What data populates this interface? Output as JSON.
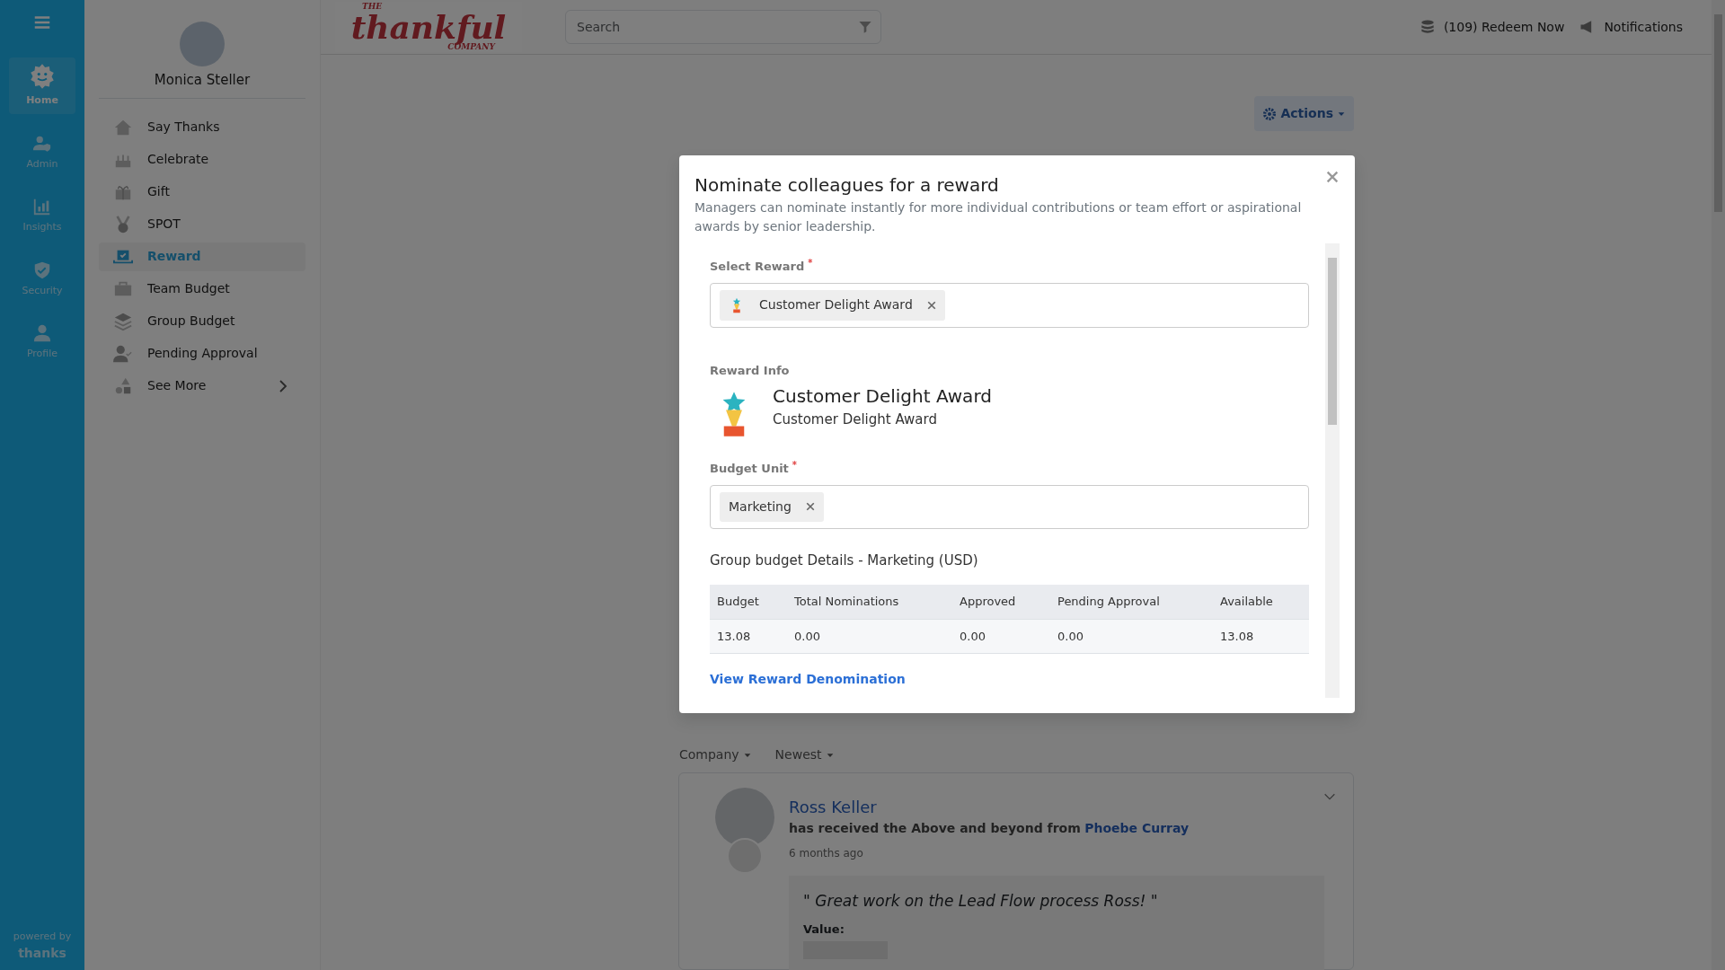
{
  "rail": {
    "items": [
      {
        "label": "Home",
        "selected": true
      },
      {
        "label": "Admin",
        "selected": false
      },
      {
        "label": "Insights",
        "selected": false
      },
      {
        "label": "Security",
        "selected": false
      },
      {
        "label": "Profile",
        "selected": false
      }
    ],
    "powered_by": "powered by",
    "brand": "thanks"
  },
  "profile": {
    "name": "Monica Steller"
  },
  "menu": [
    {
      "label": "Say Thanks",
      "selected": false,
      "expandable": false
    },
    {
      "label": "Celebrate",
      "selected": false,
      "expandable": false
    },
    {
      "label": "Gift",
      "selected": false,
      "expandable": false
    },
    {
      "label": "SPOT",
      "selected": false,
      "expandable": false
    },
    {
      "label": "Reward",
      "selected": true,
      "expandable": false
    },
    {
      "label": "Team Budget",
      "selected": false,
      "expandable": false
    },
    {
      "label": "Group Budget",
      "selected": false,
      "expandable": false
    },
    {
      "label": "Pending Approval",
      "selected": false,
      "expandable": false
    },
    {
      "label": "See More",
      "selected": false,
      "expandable": true
    }
  ],
  "header": {
    "logo": {
      "top": "THE",
      "word": "thankful",
      "bottom": "COMPANY"
    },
    "search": {
      "placeholder": "Search"
    },
    "points": "(109)",
    "redeem": "Redeem Now",
    "notifications": "Notifications"
  },
  "actions": "Actions",
  "modal": {
    "title": "Nominate colleagues for a reward",
    "subtitle": "Managers can nominate instantly for more individual contributions or team effort or aspirational awards by senior leadership.",
    "select_reward": {
      "label": "Select Reward",
      "mark": "*",
      "chips": [
        "Customer Delight Award"
      ]
    },
    "reward_info": {
      "label": "Reward Info",
      "title": "Customer Delight Award",
      "subtitle": "Customer Delight Award"
    },
    "budget_unit": {
      "label": "Budget Unit",
      "mark": "*",
      "chips": [
        "Marketing"
      ]
    },
    "budget_title": "Group budget Details - Marketing (USD)",
    "table": {
      "columns": [
        "Budget",
        "Total Nominations",
        "Approved",
        "Pending Approval",
        "Available"
      ],
      "rows": [
        [
          "13.08",
          "0.00",
          "0.00",
          "0.00",
          "13.08"
        ]
      ]
    },
    "link": "View Reward Denomination"
  },
  "feed": {
    "filters": [
      "Company",
      "Newest"
    ],
    "post": {
      "name": "Ross Keller",
      "line": "**has received the Above and beyond from**",
      "from": "Phoebe Curray",
      "time": "6 months ago",
      "quote": "\" Great work on the Lead Flow process Ross! \"",
      "value_label": "Value:"
    }
  }
}
